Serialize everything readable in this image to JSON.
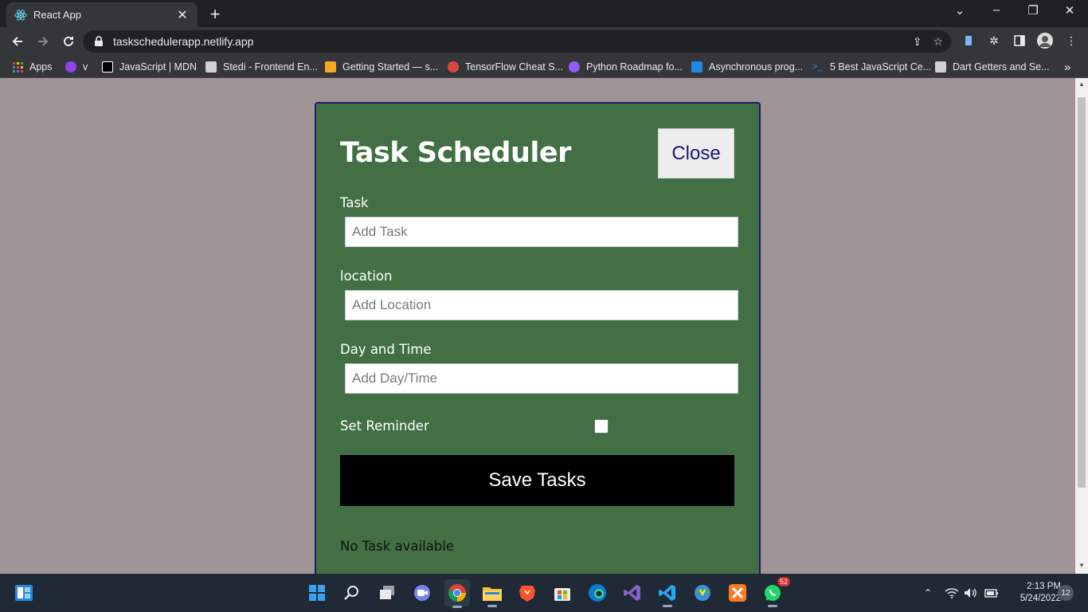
{
  "browser": {
    "tab_title": "React App",
    "url": "taskschedulerapp.netlify.app",
    "bookmarks": [
      {
        "label": "Apps",
        "color": "#e94235"
      },
      {
        "label": "v",
        "color": "#8e44ef"
      },
      {
        "label": "JavaScript | MDN",
        "color": "#ffffff"
      },
      {
        "label": "Stedi - Frontend En...",
        "color": "#cfcfcf"
      },
      {
        "label": "Getting Started — s...",
        "color": "#f5a623"
      },
      {
        "label": "TensorFlow Cheat S...",
        "color": "#d9473f"
      },
      {
        "label": "Python Roadmap fo...",
        "color": "#8f5cf7"
      },
      {
        "label": "Asynchronous prog...",
        "color": "#1e88e5"
      },
      {
        "label": "5 Best JavaScript Ce...",
        "color": "#2b88d8"
      },
      {
        "label": "Dart Getters and Se...",
        "color": "#cfcfcf"
      }
    ]
  },
  "app": {
    "title": "Task Scheduler",
    "close_label": "Close",
    "fields": {
      "task_label": "Task",
      "task_placeholder": "Add Task",
      "location_label": "location",
      "location_placeholder": "Add Location",
      "daytime_label": "Day and Time",
      "daytime_placeholder": "Add Day/Time"
    },
    "reminder_label": "Set Reminder",
    "reminder_checked": false,
    "save_label": "Save Tasks",
    "empty_message": "No Task available"
  },
  "taskbar": {
    "whatsapp_badge": "52",
    "time": "2:13 PM",
    "date": "5/24/2022",
    "notifications": "12"
  }
}
